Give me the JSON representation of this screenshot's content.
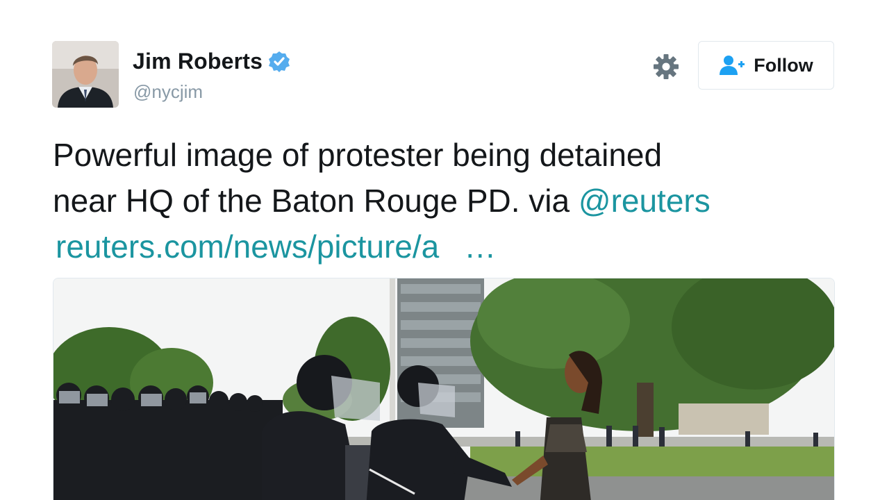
{
  "user": {
    "display_name": "Jim Roberts",
    "handle": "@nycjim",
    "verified": true,
    "avatar_icon": "profile-photo"
  },
  "actions": {
    "settings_icon": "gear-icon",
    "follow_label": "Follow",
    "follow_icon": "add-person-icon"
  },
  "tweet": {
    "text_line1": "Powerful image of protester being detained",
    "text_line2": "near HQ of the Baton Rouge PD. via ",
    "mention": "@reuters",
    "link": "reuters.com/news/picture/a",
    "ellipsis": "…"
  },
  "media": {
    "type": "photo"
  },
  "colors": {
    "link": "#1b95a0",
    "verified": "#55acee",
    "text": "#14171a",
    "secondary": "#8899a6"
  }
}
